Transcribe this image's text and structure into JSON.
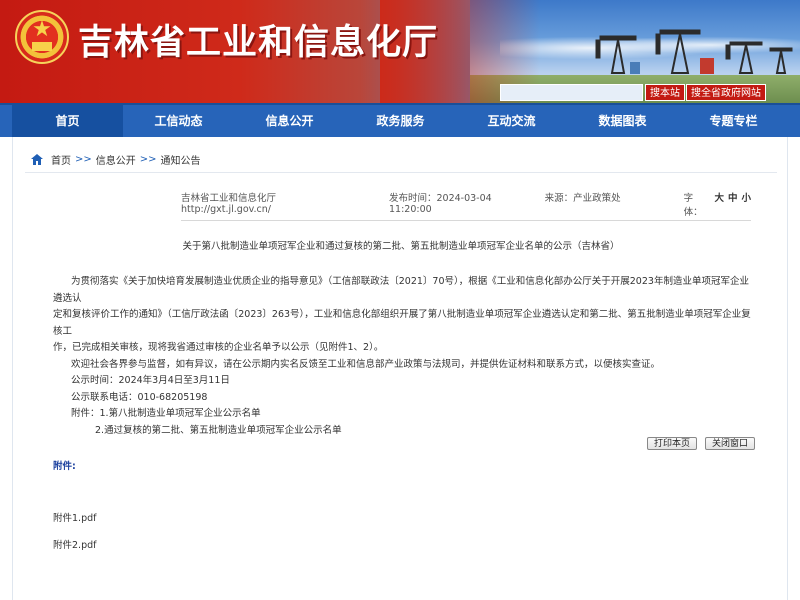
{
  "header": {
    "site_title": "吉林省工业和信息化厅",
    "search_site": "搜本站",
    "search_gov": "搜全省政府网站"
  },
  "nav": {
    "items": [
      "首页",
      "工信动态",
      "信息公开",
      "政务服务",
      "互动交流",
      "数据图表",
      "专题专栏"
    ]
  },
  "breadcrumb": {
    "home": "首页",
    "sep": ">>",
    "level2": "信息公开",
    "level3": "通知公告"
  },
  "meta": {
    "source_site": "吉林省工业和信息化厅 http://gxt.jl.gov.cn/",
    "publish_time": "发布时间：2024-03-04 11:20:00",
    "origin": "来源：产业政策处",
    "font_label": "字体：",
    "font_large": "大",
    "font_medium": "中",
    "font_small": "小"
  },
  "article": {
    "title": "关于第八批制造业单项冠军企业和通过复核的第二批、第五批制造业单项冠军企业名单的公示（吉林省）",
    "para1_l1": "为贯彻落实《关于加快培育发展制造业优质企业的指导意见》（工信部联政法〔2021〕70号），根据《工业和信息化部办公厅关于开展2023年制造业单项冠军企业遴选认",
    "para1_l2": "定和复核评价工作的通知》（工信厅政法函〔2023〕263号），工业和信息化部组织开展了第八批制造业单项冠军企业遴选认定和第二批、第五批制造业单项冠军企业复核工",
    "para1_l3": "作，已完成相关审核，现将我省通过审核的企业名单予以公示（见附件1、2）。",
    "para2": "欢迎社会各界参与监督，如有异议，请在公示期内实名反馈至工业和信息部产业政策与法规司，并提供佐证材料和联系方式，以便核实查证。",
    "period": "公示时间：2024年3月4日至3月11日",
    "phone": "公示联系电话：010-68205198",
    "attach1": "附件：1.第八批制造业单项冠军企业公示名单",
    "attach2": "2.通过复核的第二批、第五批制造业单项冠军企业公示名单"
  },
  "buttons": {
    "print": "打印本页",
    "close": "关闭窗口"
  },
  "attachments": {
    "label": "附件:",
    "files": [
      "附件1.pdf",
      "附件2.pdf"
    ]
  },
  "colors": {
    "nav_blue": "#2764b9",
    "header_red": "#c41a12",
    "link_blue": "#1f43a0"
  }
}
